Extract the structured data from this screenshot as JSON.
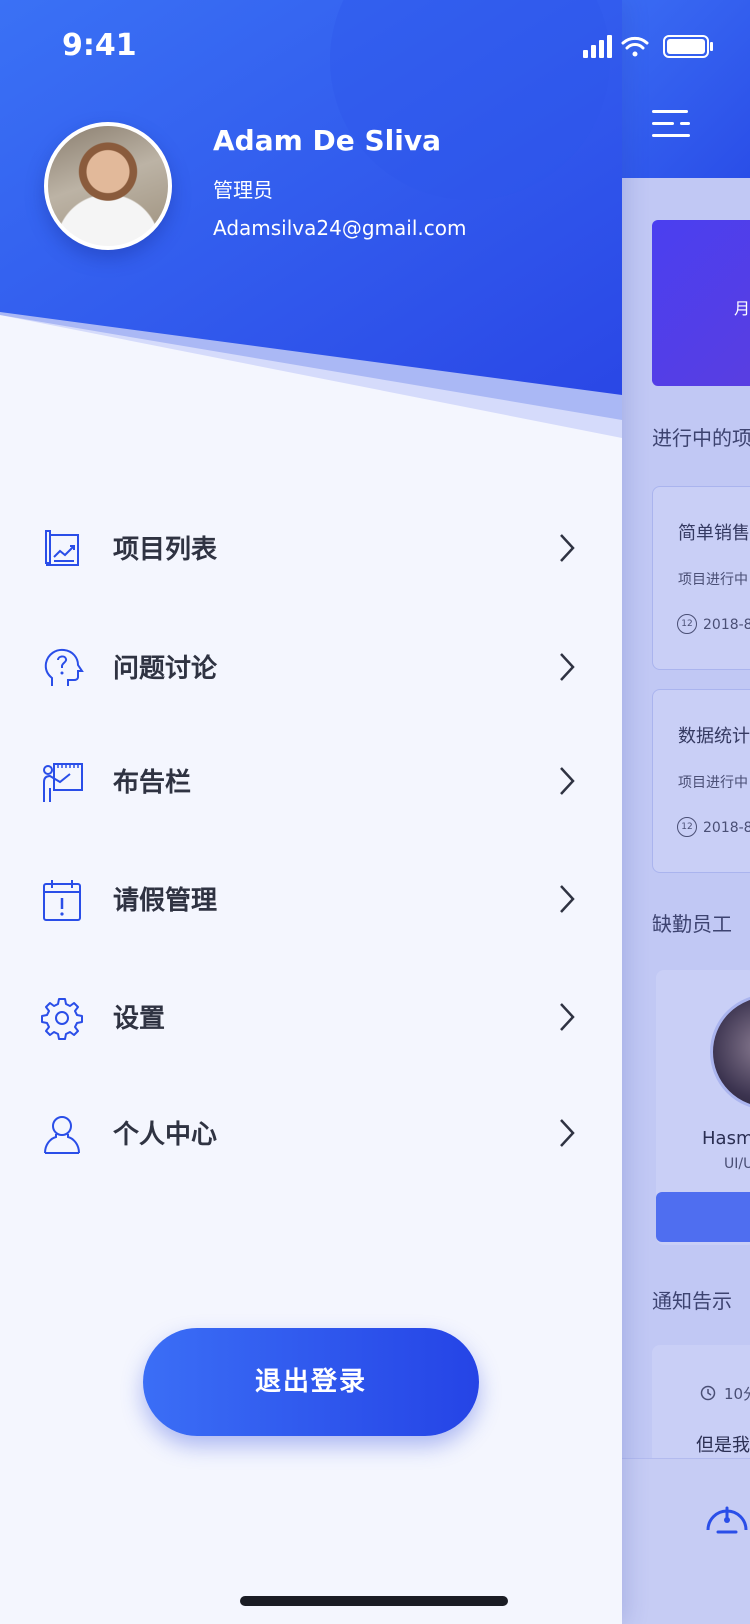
{
  "status_bar": {
    "time": "9:41"
  },
  "user": {
    "name": "Adam De Sliva",
    "role": "管理员",
    "email": "Adamsilva24@gmail.com"
  },
  "menu": {
    "items": [
      {
        "label": "项目列表",
        "icon": "project-chart-icon"
      },
      {
        "label": "问题讨论",
        "icon": "question-head-icon"
      },
      {
        "label": "布告栏",
        "icon": "presentation-board-icon"
      },
      {
        "label": "请假管理",
        "icon": "calendar-alert-icon"
      },
      {
        "label": "设置",
        "icon": "gear-icon"
      },
      {
        "label": "个人中心",
        "icon": "user-icon"
      }
    ],
    "logout_label": "退出登录"
  },
  "background": {
    "banner_text": "月",
    "section_projects": "进行中的项",
    "projects": [
      {
        "title": "简单销售",
        "status": "项目进行中",
        "date": "2018-8"
      },
      {
        "title": "数据统计",
        "status": "项目进行中",
        "date": "2018-8"
      }
    ],
    "clock_number": "12",
    "section_absent": "缺勤员工",
    "absent_employee": {
      "name": "Hasm",
      "role": "UI/U"
    },
    "section_notice": "通知告示",
    "notice": {
      "time": "10分",
      "text": "但是我"
    }
  },
  "colors": {
    "accent": "#2a4ee8",
    "accent_light": "#3b6ef6",
    "drawer_bg": "#f4f6fe",
    "text_dark": "#2f3342"
  }
}
